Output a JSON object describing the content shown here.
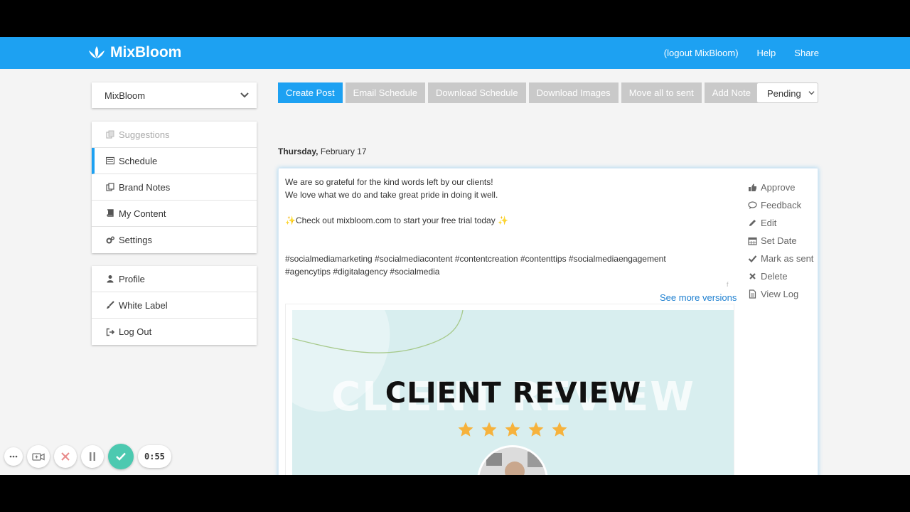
{
  "header": {
    "brand": "MixBloom",
    "nav": [
      "(logout MixBloom)",
      "Help",
      "Share"
    ],
    "color": "#1da1f2"
  },
  "account_select": {
    "value": "MixBloom"
  },
  "sidebar": {
    "main_menu": [
      {
        "label": "Suggestions",
        "icon": "copy-icon",
        "state": "disabled"
      },
      {
        "label": "Schedule",
        "icon": "list-icon",
        "state": "active"
      },
      {
        "label": "Brand Notes",
        "icon": "notes-icon",
        "state": "normal"
      },
      {
        "label": "My Content",
        "icon": "book-icon",
        "state": "normal"
      },
      {
        "label": "Settings",
        "icon": "gears-icon",
        "state": "normal"
      }
    ],
    "account_menu": [
      {
        "label": "Profile",
        "icon": "user-icon"
      },
      {
        "label": "White Label",
        "icon": "brush-icon"
      },
      {
        "label": "Log Out",
        "icon": "logout-icon"
      }
    ]
  },
  "toolbar": {
    "buttons": [
      "Create Post",
      "Email Schedule",
      "Download Schedule",
      "Download Images",
      "Move all to sent",
      "Add Note"
    ],
    "status_value": "Pending"
  },
  "schedule": {
    "day": "Thursday,",
    "date": "February 17"
  },
  "post": {
    "caption": "We are so grateful for the kind words left by our clients!\nWe love what we do and take great pride in doing it well.\n\n✨Check out mixbloom.com to start your free trial today ✨\n\n\n#socialmediamarketing #socialmediacontent #contentcreation #contenttips #socialmediaengagement\n#agencytips #digitalagency #socialmedia",
    "platform_mark": "f",
    "more_versions": "See more versions",
    "image": {
      "title": "CLIENT REVIEW",
      "ghost_title": "CLIENT REVIEW",
      "stars": 5,
      "background": "#d8eeef"
    },
    "actions": [
      {
        "label": "Approve",
        "icon": "thumbs-up-icon"
      },
      {
        "label": "Feedback",
        "icon": "comment-icon"
      },
      {
        "label": "Edit",
        "icon": "pencil-icon"
      },
      {
        "label": "Set Date",
        "icon": "calendar-icon"
      },
      {
        "label": "Mark as sent",
        "icon": "check-icon"
      },
      {
        "label": "Delete",
        "icon": "x-icon"
      },
      {
        "label": "View Log",
        "icon": "file-icon"
      }
    ]
  },
  "recorder": {
    "timer": "0:55"
  }
}
